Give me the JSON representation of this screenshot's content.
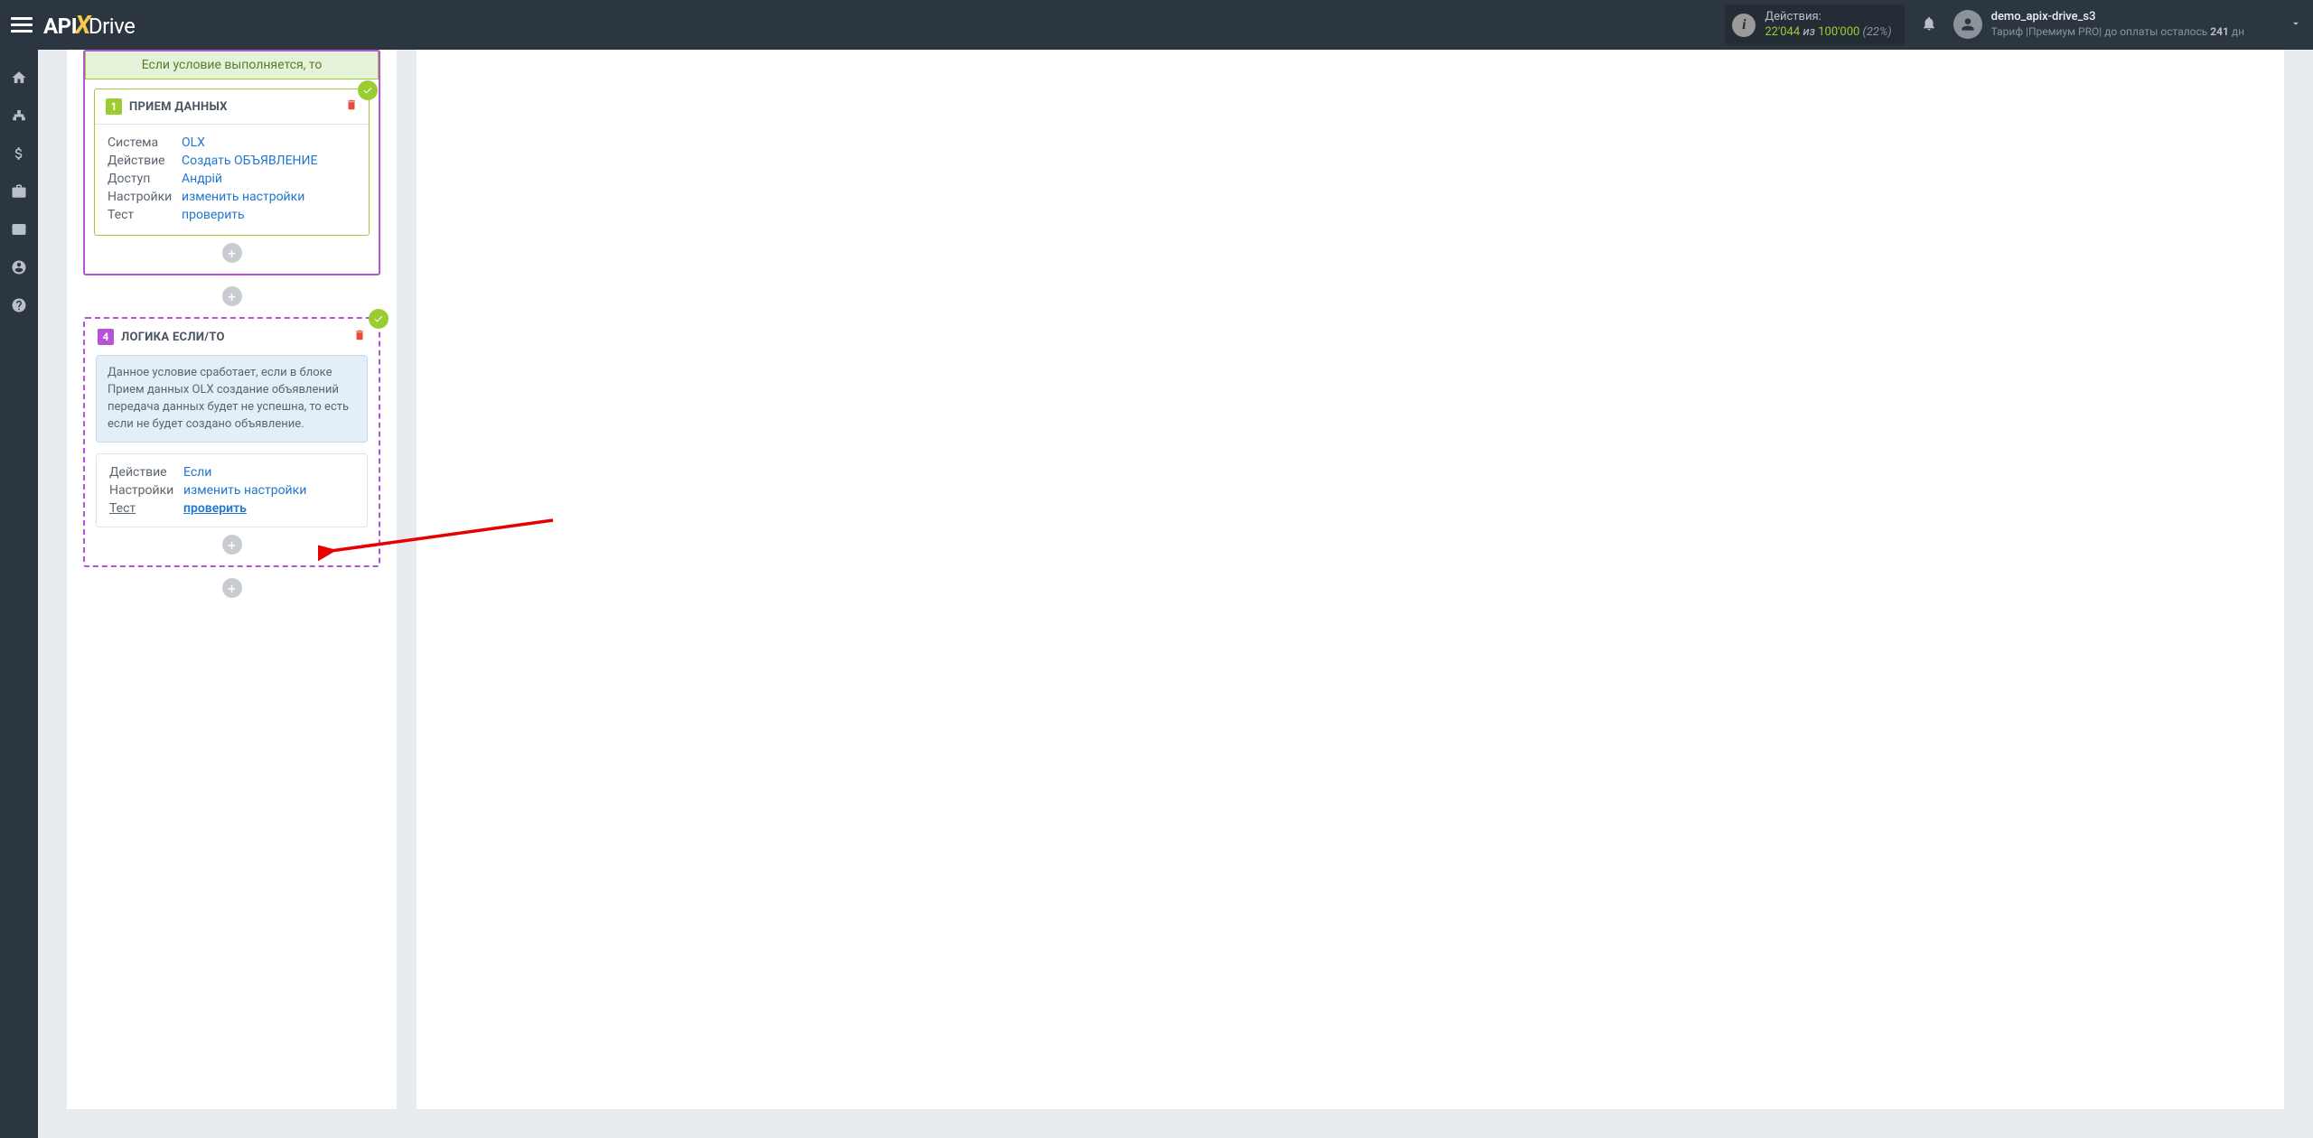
{
  "header": {
    "actions_label": "Действия:",
    "actions_v1": "22'044",
    "actions_iz": " из ",
    "actions_v2": "100'000",
    "actions_pct": " (22%)",
    "user_name": "demo_apix-drive_s3",
    "tariff_prefix": "Тариф |",
    "tariff_name": "Премиум PRO",
    "tariff_mid": "| до оплаты осталось ",
    "tariff_days": "241",
    "tariff_suffix": " дн"
  },
  "cond_header": "Если условие выполняется, то",
  "block1": {
    "num": "1",
    "title": "ПРИЕМ ДАННЫХ",
    "rows": {
      "system_k": "Система",
      "system_v": "OLX",
      "action_k": "Действие",
      "action_v": "Создать ОБЪЯВЛЕНИЕ",
      "access_k": "Доступ",
      "access_v": "Андрій",
      "settings_k": "Настройки",
      "settings_v": "изменить настройки",
      "test_k": "Тест",
      "test_v": "проверить"
    }
  },
  "block4": {
    "num": "4",
    "title": "ЛОГИКА ЕСЛИ/ТО",
    "info": "Данное условие сработает, если в блоке Прием данных OLX создание объявлений передача данных будет не успешна, то есть если не будет создано объявление.",
    "rows": {
      "action_k": "Действие",
      "action_v": "Если",
      "settings_k": "Настройки",
      "settings_v": "изменить настройки",
      "test_k": "Тест",
      "test_v": "проверить"
    }
  }
}
